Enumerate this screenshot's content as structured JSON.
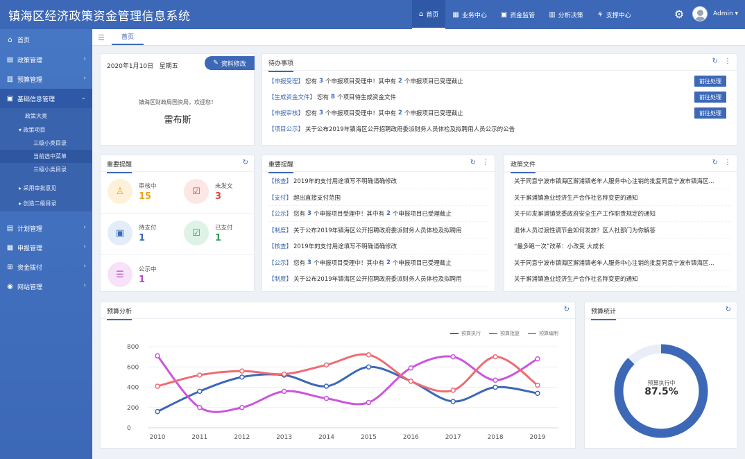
{
  "app": {
    "title": "镇海区经济政策资金管理信息系统"
  },
  "topnav": [
    {
      "label": "首页",
      "icon": "home-icon",
      "glyph": "⌂"
    },
    {
      "label": "业务中心",
      "icon": "grid-icon",
      "glyph": "▦"
    },
    {
      "label": "资金监管",
      "icon": "monitor-icon",
      "glyph": "▣"
    },
    {
      "label": "分析决策",
      "icon": "bar-chart-icon",
      "glyph": "▥"
    },
    {
      "label": "支撑中心",
      "icon": "sitemap-icon",
      "glyph": "⚘"
    }
  ],
  "user": {
    "name": "Admin ▾"
  },
  "sidebar": {
    "items": [
      {
        "label": "首页",
        "glyph": "⌂"
      },
      {
        "label": "政策管理",
        "glyph": "▤"
      },
      {
        "label": "预算管理",
        "glyph": "▥"
      },
      {
        "label": "基础信息管理",
        "glyph": "▣"
      }
    ],
    "sub": [
      {
        "label": "政策大类"
      },
      {
        "label": "▾ 政策项目"
      },
      {
        "label": "三级小类目录"
      },
      {
        "label": "当前选中菜单"
      },
      {
        "label": "三级小类目录"
      },
      {
        "label": "▸ 采用审批意见"
      },
      {
        "label": "▸ 创造二级目录"
      }
    ],
    "items2": [
      {
        "label": "计划管理",
        "glyph": "▤"
      },
      {
        "label": "申报管理",
        "glyph": "▦"
      },
      {
        "label": "资金拨付",
        "glyph": "⊞"
      },
      {
        "label": "网站管理",
        "glyph": "◉"
      }
    ]
  },
  "tabs": {
    "home": "首页"
  },
  "profile": {
    "date": "2020年1月10日",
    "weekday": "星期五",
    "edit_label": "资料修改",
    "welcome": "镇海区财政局国资局，欢迎您！",
    "username": "雷布斯"
  },
  "todo": {
    "title": "待办事项",
    "rows": [
      {
        "tag": "【申报受理】",
        "pre": "您有",
        "n1": "3",
        "mid": "个申报项目受理中！其中有",
        "n2": "2",
        "post": "个申报项目已受理截止",
        "btn": "前往处理"
      },
      {
        "tag": "【生成资金文件】",
        "pre": "您有",
        "n1": "8",
        "mid": "个项目待生成资金文件",
        "n2": "",
        "post": "",
        "btn": "前往处理"
      },
      {
        "tag": "【申报审核】",
        "pre": "您有",
        "n1": "3",
        "mid": "个申报项目受理中！其中有",
        "n2": "2",
        "post": "个申报项目已受理截止",
        "btn": "前往处理"
      },
      {
        "tag": "【项目公示】",
        "pre": "关于公布2019年镇海区公开招聘政府委派财务人员体检及拟聘用人员公示的公告",
        "n1": "",
        "mid": "",
        "n2": "",
        "post": "",
        "btn": ""
      }
    ]
  },
  "reminders_stats": {
    "title": "重要提醒",
    "items": [
      {
        "label": "审核中",
        "value": "15",
        "icon": "stamp-icon",
        "glyph": "♙",
        "bg": "#fdf1d9",
        "fg": "#e9a21e"
      },
      {
        "label": "未发文",
        "value": "3",
        "icon": "document-check-icon",
        "glyph": "☑",
        "bg": "#fde6e3",
        "fg": "#d9463a"
      },
      {
        "label": "待支付",
        "value": "1",
        "icon": "wallet-icon",
        "glyph": "▣",
        "bg": "#e3edfa",
        "fg": "#3c68b7"
      },
      {
        "label": "已支付",
        "value": "1",
        "icon": "paid-icon",
        "glyph": "☑",
        "bg": "#def3e5",
        "fg": "#2e9e53"
      },
      {
        "label": "公示中",
        "value": "1",
        "icon": "announce-icon",
        "glyph": "☰",
        "bg": "#f6e3f7",
        "fg": "#b64cc5"
      }
    ]
  },
  "reminders_list": {
    "title": "重要提醒",
    "rows": [
      {
        "tag": "【核查】",
        "pre": "2019年的支付用途填写不明确请确修改",
        "n1": "",
        "mid": "",
        "n2": "",
        "post": ""
      },
      {
        "tag": "【支付】",
        "pre": "超出直接支付范围",
        "n1": "",
        "mid": "",
        "n2": "",
        "post": ""
      },
      {
        "tag": "【公示】",
        "pre": "您有",
        "n1": "3",
        "mid": "个申报项目受理中！其中有",
        "n2": "2",
        "post": "个申报项目已受理截止"
      },
      {
        "tag": "【制度】",
        "pre": "关于公布2019年镇海区公开招聘政府委派财务人员体检及拟聘用",
        "n1": "",
        "mid": "",
        "n2": "",
        "post": ""
      },
      {
        "tag": "【核查】",
        "pre": "2019年的支付用途填写不明确请确修改",
        "n1": "",
        "mid": "",
        "n2": "",
        "post": ""
      },
      {
        "tag": "【公示】",
        "pre": "您有",
        "n1": "3",
        "mid": "个申报项目受理中！其中有",
        "n2": "2",
        "post": "个申报项目已受理截止"
      },
      {
        "tag": "【制度】",
        "pre": "关于公布2019年镇海区公开招聘政府委派财务人员体检及拟聘用",
        "n1": "",
        "mid": "",
        "n2": "",
        "post": ""
      }
    ]
  },
  "policy_docs": {
    "title": "政策文件",
    "rows": [
      "关于同意宁波市镇海区澥浦镇老年人服务中心注销的批复同意宁波市镇海区...",
      "关于澥浦镇渔业经济生产合作社名称变更的通知",
      "关于印发澥浦镇党委政府安全生产工作职责规定的通知",
      "退休人员过渡性调节金如何发放？区人社部门为你解答",
      "“最多跑一次”改革：小改变 大成长",
      "关于同意宁波市镇海区澥浦镇老年人服务中心注销的批复同意宁波市镇海区...",
      "关于澥浦镇渔业经济生产合作社名称变更的通知"
    ]
  },
  "budget_analysis": {
    "title": "预算分析"
  },
  "budget_stats": {
    "title": "预算统计",
    "gauge_label": "预算执行中",
    "gauge_value": "87.5%",
    "ratio": 0.875
  },
  "chart_data": [
    {
      "type": "line",
      "title": "预算分析",
      "x": [
        "2010",
        "2011",
        "2012",
        "2013",
        "2014",
        "2015",
        "2016",
        "2017",
        "2018",
        "2019"
      ],
      "ylim": [
        0,
        800
      ],
      "yticks": [
        "0",
        "200",
        "400",
        "600",
        "800"
      ],
      "legend_position": "top-right",
      "grid": true,
      "series": [
        {
          "name": "预算执行",
          "color": "#3c68b7",
          "values": [
            160,
            360,
            500,
            520,
            410,
            600,
            460,
            260,
            400,
            340
          ]
        },
        {
          "name": "预算批复",
          "color": "#cc55dd",
          "values": [
            710,
            200,
            200,
            360,
            290,
            250,
            590,
            700,
            470,
            680
          ]
        },
        {
          "name": "预算编制",
          "color": "#f06b73",
          "values": [
            410,
            520,
            560,
            530,
            620,
            720,
            460,
            370,
            700,
            420
          ]
        }
      ]
    },
    {
      "type": "pie",
      "title": "预算统计",
      "categories": [
        "预算执行中"
      ],
      "values": [
        87.5
      ]
    }
  ],
  "colors": {
    "primary": "#3c68b7",
    "primary_dark": "#2f59a6"
  }
}
